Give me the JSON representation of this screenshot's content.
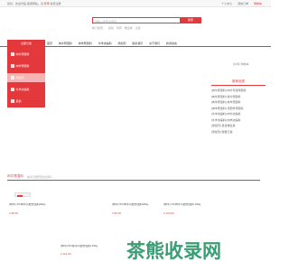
{
  "topbar": {
    "welcome": "您好，欢迎光临 健康网站，请",
    "login": "登录",
    "register": "免费注册",
    "links": [
      "个人中心",
      "我的订单",
      "购物车"
    ]
  },
  "search": {
    "placeholder": "请输入搜索关键词",
    "button": "搜索",
    "hot_words": [
      "热门搜索：",
      "感冒",
      "胃药",
      "维生素",
      "止咳"
    ]
  },
  "nav": {
    "category": "全部分类",
    "items": [
      "首页",
      "肉牛预混料",
      "肉羊预混料",
      "牛羊浓缩料",
      "添加剂",
      "联系我们",
      "关于我们",
      "新闻动态"
    ]
  },
  "sidemenu": {
    "items": [
      "肉牛预混料",
      "肉羊预混料",
      "添加剂",
      "牛羊浓缩料",
      "其他"
    ]
  },
  "cart": {
    "text": "共0件 购物车",
    "count": "0"
  },
  "recommend": {
    "title": "推荐品类",
    "items": [
      "[肉牛预混料] 肉牛专用预混料",
      "[肉牛预混料] 犊牛预混料",
      "[肉羊预混料] 羔羊预混料",
      "[肉羊预混料] 育肥羊预混料",
      "[牛羊浓缩料] 肉牛浓缩料",
      "[牛羊浓缩料] 肉羊浓缩料",
      "[添加剂] 复合维生素",
      "[添加剂] 微量元素"
    ]
  },
  "section": {
    "title": "肉牛预混料",
    "subtitle": "肉牛育肥预混合饲料"
  },
  "products": [
    {
      "name": "[肉牛] 4%肉牛育肥预混料40kg",
      "price": "¥ 68.00"
    },
    {
      "name": "[肉牛] 5%肉牛育肥预混料25kg",
      "price": "¥ 82.00"
    },
    {
      "name": "[肉牛] 1%肉牛育肥预混料 25kg",
      "price": "¥ 104.00"
    },
    {
      "name": "[肉牛] 5%犊牛育肥预混料 25kg",
      "price": "¥ 112.00"
    }
  ],
  "watermark": "茶熊收录网"
}
